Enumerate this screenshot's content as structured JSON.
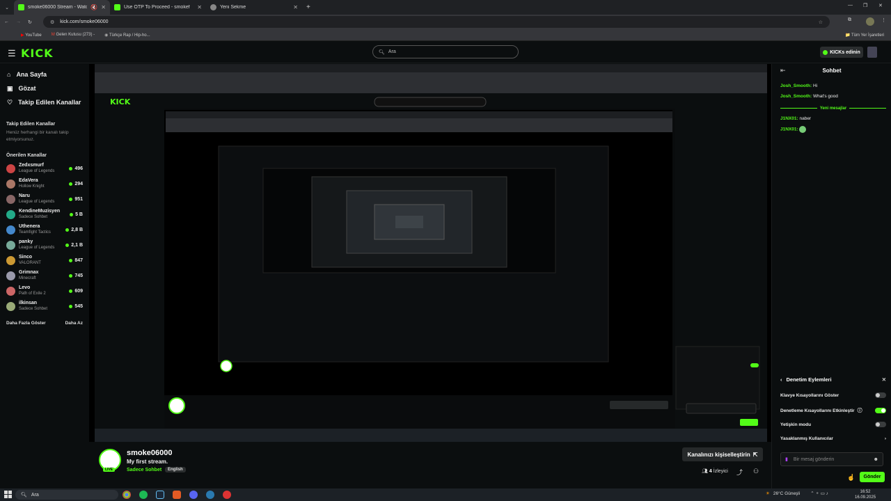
{
  "browser": {
    "tabs": [
      {
        "title": "smoke06000 Stream - Watc",
        "active": true
      },
      {
        "title": "Use OTP To Proceed - smokef",
        "active": false
      },
      {
        "title": "Yeni Sekme",
        "active": false
      }
    ],
    "url": "kick.com/smoke06000",
    "bookmarks": [
      "YouTube",
      "Gelen Kutusu (273) -",
      "Türkçe Rap / Hip-ho..."
    ],
    "all_bookmarks": "Tüm Yer İşaretleri"
  },
  "header": {
    "logo": "KICK",
    "search_placeholder": "Ara",
    "kicks_button": "KICKs edinin"
  },
  "sidebar": {
    "nav": [
      {
        "label": "Ana Sayfa",
        "icon": "home-icon"
      },
      {
        "label": "Gözat",
        "icon": "compass-icon"
      },
      {
        "label": "Takip Edilen Kanallar",
        "icon": "heart-icon"
      }
    ],
    "followed_heading": "Takip Edilen Kanallar",
    "followed_note": "Henüz herhangi bir kanalı takip etmiyorsunuz.",
    "recommended_heading": "Önerilen Kanallar",
    "channels": [
      {
        "name": "Zedxsmurf",
        "game": "League of Legends",
        "viewers": "496"
      },
      {
        "name": "EdaVera",
        "game": "Hollow Knight",
        "viewers": "294"
      },
      {
        "name": "Naru",
        "game": "League of Legends",
        "viewers": "951"
      },
      {
        "name": "KendineMuzisyen",
        "game": "Sadece Sohbet",
        "viewers": "5 B"
      },
      {
        "name": "Uthenera",
        "game": "Teamfight Tactics",
        "viewers": "2,8 B"
      },
      {
        "name": "panky",
        "game": "League of Legends",
        "viewers": "2,1 B"
      },
      {
        "name": "Sinco",
        "game": "VALORANT",
        "viewers": "847"
      },
      {
        "name": "Grimnax",
        "game": "Minecraft",
        "viewers": "745"
      },
      {
        "name": "Levo",
        "game": "Path of Exile 2",
        "viewers": "609"
      },
      {
        "name": "ilkinsan",
        "game": "Sadece Sohbet",
        "viewers": "545"
      }
    ],
    "show_more": "Daha Fazla Göster",
    "show_less": "Daha Az"
  },
  "stream": {
    "channel": "smoke06000",
    "title": "My first stream.",
    "category": "Sadece Sohbet",
    "language": "English",
    "live_badge": "LIVE",
    "customize_button": "Kanalınızı kişiselleştirin",
    "viewers_count": "4",
    "viewers_label": "İzleyici"
  },
  "chat": {
    "title": "Sohbet",
    "messages": [
      {
        "user": "Josh_Smooth:",
        "text": "Hi"
      },
      {
        "user": "Josh_Smooth:",
        "text": "What's good"
      }
    ],
    "new_messages_label": "Yeni mesajlar",
    "new_messages": [
      {
        "user": "J1NX01:",
        "text": "naber"
      },
      {
        "user": "J1NX01:",
        "text": ""
      }
    ],
    "mod_panel": {
      "title": "Denetim Eylemleri",
      "rows": [
        {
          "label": "Klavye Kısayollarını Göster",
          "toggle": false
        },
        {
          "label": "Denetleme Kısayollarını Etkinleştir",
          "toggle": true
        },
        {
          "label": "Yetişkin modu",
          "toggle": false
        },
        {
          "label": "Yasaklanmış Kullanıcılar",
          "toggle": null
        }
      ]
    },
    "input_placeholder": "Bir mesaj gönderin",
    "send_button": "Gönder"
  },
  "taskbar": {
    "search": "Ara",
    "weather": "26°C  Güneşli",
    "time": "16:52",
    "date": "16.09.2025"
  },
  "colors": {
    "accent": "#53fc18",
    "background": "#0b0e0f"
  }
}
